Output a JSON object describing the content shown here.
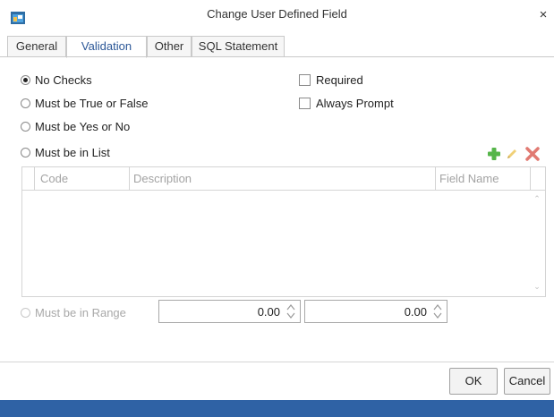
{
  "window": {
    "title": "Change User Defined Field",
    "close_label": "×"
  },
  "tabs": [
    {
      "label": "General"
    },
    {
      "label": "Validation",
      "active": true
    },
    {
      "label": "Other"
    },
    {
      "label": "SQL Statement"
    }
  ],
  "validation": {
    "options": [
      {
        "label": "No Checks",
        "checked": true,
        "enabled": true
      },
      {
        "label": "Must be True or False",
        "checked": false,
        "enabled": true
      },
      {
        "label": "Must be Yes or No",
        "checked": false,
        "enabled": true
      },
      {
        "label": "Must be in List",
        "checked": false,
        "enabled": true
      },
      {
        "label": "Must be in Range",
        "checked": false,
        "enabled": false
      }
    ],
    "required_label": "Required",
    "always_prompt_label": "Always Prompt",
    "required_checked": false,
    "always_prompt_checked": false
  },
  "list_toolbar": {
    "icons": [
      "add-icon",
      "edit-icon",
      "delete-icon"
    ]
  },
  "list_grid": {
    "columns": [
      "Code",
      "Description",
      "Field Name"
    ],
    "rows": []
  },
  "range": {
    "min": "0.00",
    "max": "0.00"
  },
  "buttons": {
    "ok": "OK",
    "cancel": "Cancel"
  },
  "colors": {
    "accent": "#2b5797",
    "status_bar": "#2f62a5"
  }
}
